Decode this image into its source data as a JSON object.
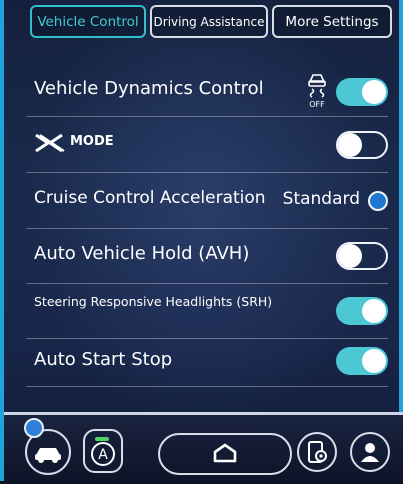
{
  "tabs": [
    {
      "label": "Vehicle Control",
      "active": true
    },
    {
      "label": "Driving Assistance",
      "active": false
    },
    {
      "label": "More Settings",
      "active": false
    }
  ],
  "settings": {
    "vdc": {
      "label": "Vehicle Dynamics Control",
      "icon": "vdc-off-icon",
      "icon_text": "OFF",
      "state": "on"
    },
    "xmode": {
      "label": "MODE",
      "logo": "x-mode-logo",
      "state": "off"
    },
    "cruise": {
      "label": "Cruise Control Acceleration",
      "value": "Standard"
    },
    "avh": {
      "label": "Auto Vehicle Hold (AVH)",
      "state": "off"
    },
    "srh": {
      "label": "Steering Responsive Headlights (SRH)",
      "state": "on"
    },
    "autostart": {
      "label": "Auto Start Stop",
      "state": "on"
    }
  },
  "bottom_nav": {
    "items": [
      "car-icon",
      "auto-a-icon",
      "home-icon",
      "phone-settings-icon",
      "profile-icon"
    ]
  },
  "colors": {
    "accent": "#4cc8d4",
    "active_tab": "#42cbd3",
    "radio": "#1e78d2",
    "frame": "#1ea4d8",
    "indicator_green": "#52d06a"
  }
}
